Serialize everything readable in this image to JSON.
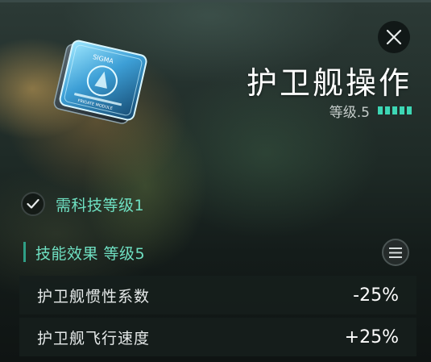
{
  "skill": {
    "title": "护卫舰操作",
    "level_label": "等级.5",
    "level_value": 5,
    "level_max": 5
  },
  "card": {
    "brand_text": "SIGMA",
    "caption_text": "FRIGATE MODULE",
    "icon": "skillbook-card-icon"
  },
  "requirement": {
    "text": "需科技等级1",
    "icon": "check-icon"
  },
  "effects_section": {
    "title": "技能效果 等级5",
    "menu_icon": "menu-icon",
    "rows": [
      {
        "label": "护卫舰惯性系数",
        "value": "-25%"
      },
      {
        "label": "护卫舰飞行速度",
        "value": "+25%"
      }
    ]
  },
  "close": {
    "icon": "close-icon"
  },
  "colors": {
    "accent": "#6fe0c2",
    "pip": "#3dd6b4",
    "card_glow": "#58c8ff"
  }
}
